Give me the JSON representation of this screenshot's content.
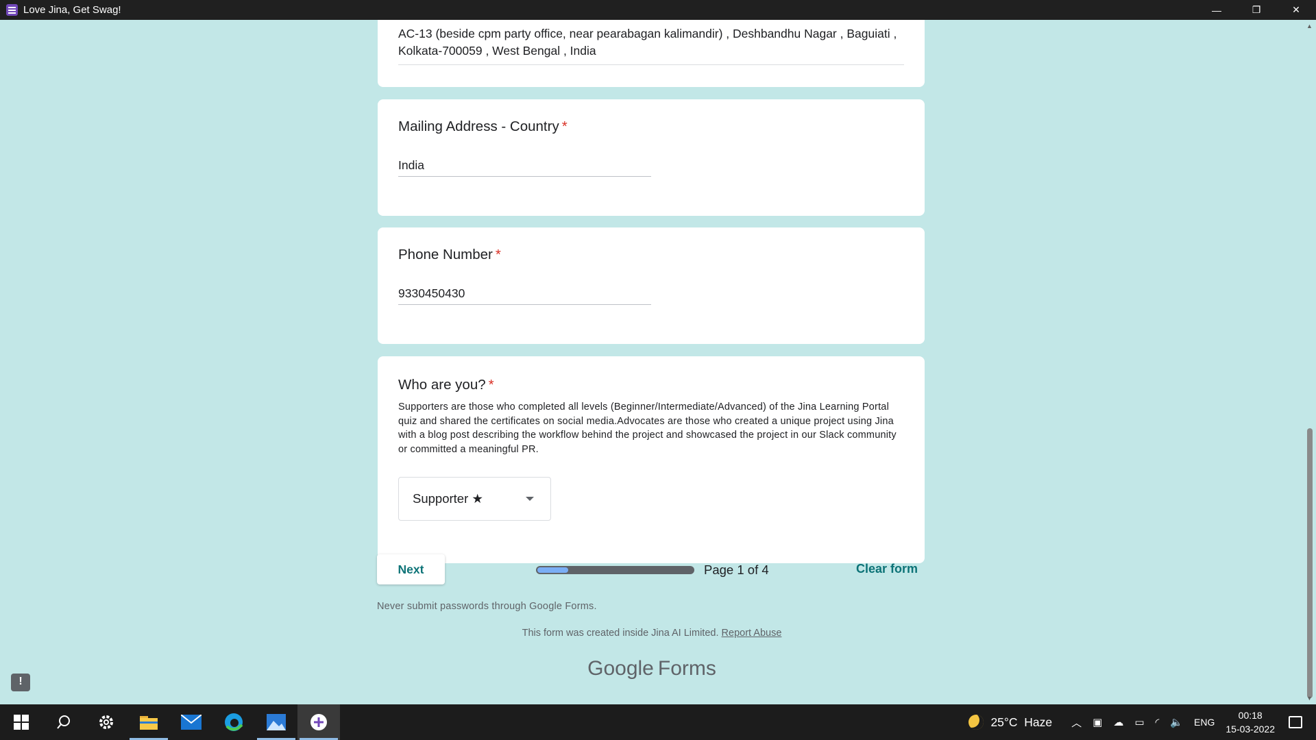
{
  "window": {
    "title": "Love Jina, Get Swag!",
    "minimize": "—",
    "restore": "❐",
    "close": "✕"
  },
  "form": {
    "address_value": "AC-13 (beside cpm party office, near pearabagan kalimandir) , Deshbandhu Nagar , Baguiati , Kolkata-700059 , West Bengal , India",
    "country": {
      "title": "Mailing Address - Country",
      "required": "*",
      "value": "India"
    },
    "phone": {
      "title": "Phone Number",
      "required": "*",
      "value": "9330450430"
    },
    "who": {
      "title": "Who are you?",
      "required": "*",
      "description": "Supporters are those who completed all levels (Beginner/Intermediate/Advanced) of the Jina Learning Portal quiz and shared the certificates on social media.Advocates are those who created a unique project using Jina with a blog post describing the workflow behind the project and showcased the project in our Slack community or committed a meaningful PR.",
      "selected": "Supporter ★"
    },
    "next_label": "Next",
    "progress_fraction": 0.2,
    "page_text": "Page 1 of 4",
    "clear_label": "Clear form",
    "never_text": "Never submit passwords through Google Forms.",
    "created_text": "This form was created inside Jina AI Limited.",
    "report_label": "Report Abuse",
    "brand_google": "Google",
    "brand_forms": "Forms",
    "feedback_icon": "!"
  },
  "taskbar": {
    "weather_temp": "25°C",
    "weather_desc": "Haze",
    "lang": "ENG",
    "time": "00:18",
    "date": "15-03-2022"
  },
  "colors": {
    "background": "#c2e7e7",
    "accent": "#0d7377",
    "required": "#d93025",
    "progress_fill": "#7aaef5"
  }
}
